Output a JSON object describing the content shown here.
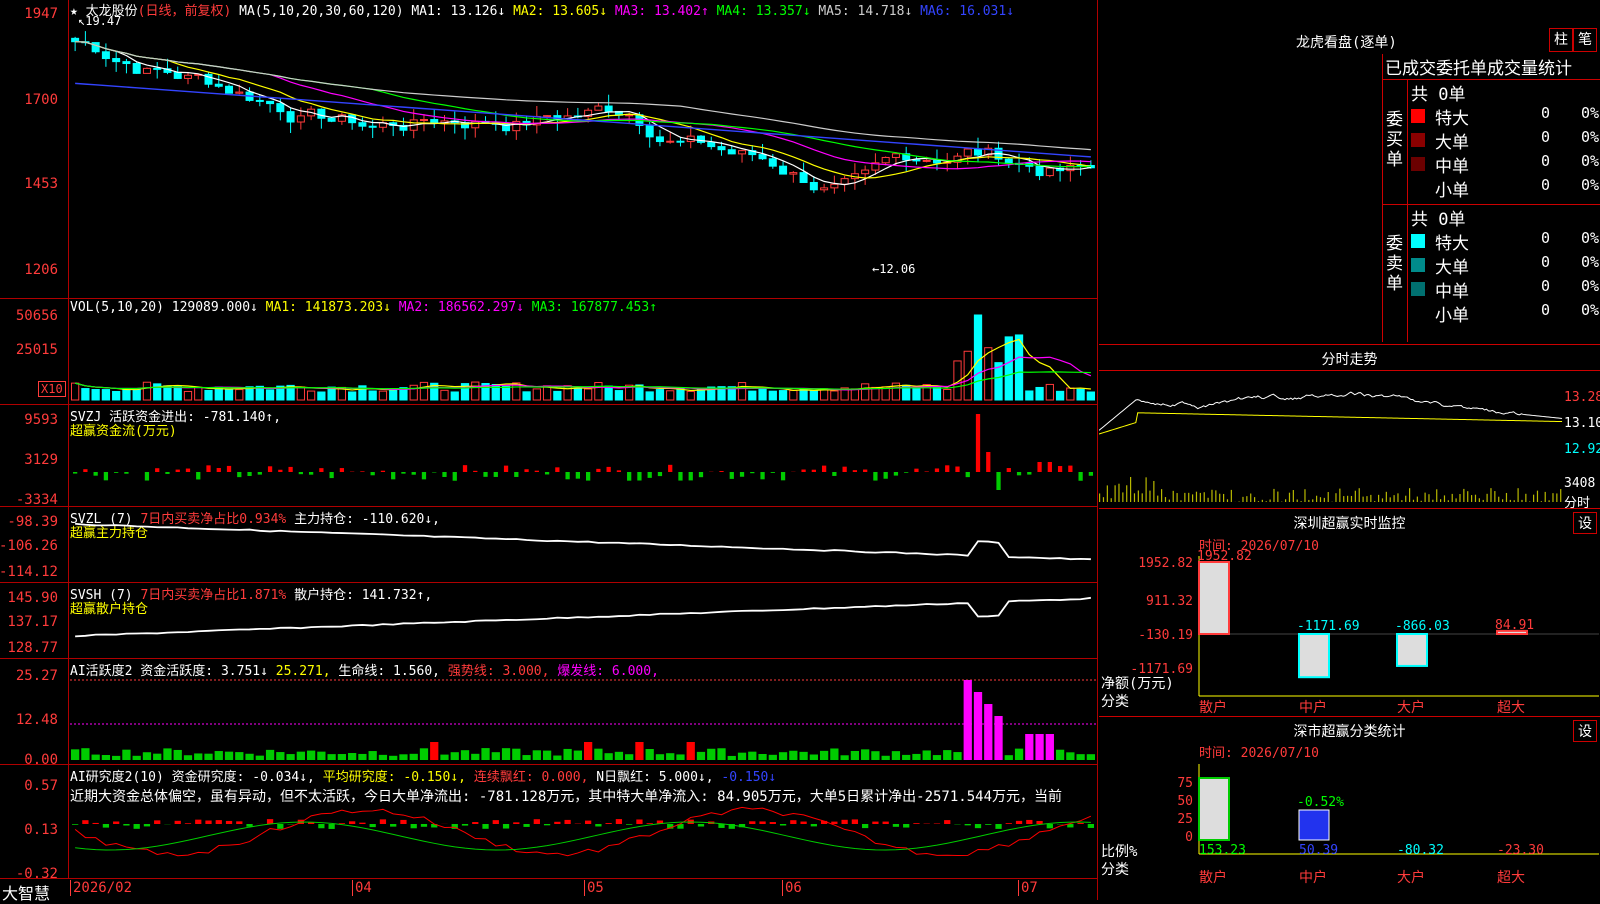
{
  "app": {
    "brand": "大智慧",
    "stock_name": "太龙股份",
    "period": "(日线，前复权)"
  },
  "price_panel": {
    "ma_label": "MA(5,10,20,30,60,120)",
    "ma": [
      {
        "name": "MA1:",
        "value": "13.126↓",
        "color": "#ffffff"
      },
      {
        "name": "MA2:",
        "value": "13.605↓",
        "color": "#ffff00"
      },
      {
        "name": "MA3:",
        "value": "13.402↑",
        "color": "#ff00ff"
      },
      {
        "name": "MA4:",
        "value": "13.357↓",
        "color": "#00ff00"
      },
      {
        "name": "MA5:",
        "value": "14.718↓",
        "color": "#cccccc"
      },
      {
        "name": "MA6:",
        "value": "16.031↓",
        "color": "#3344ff"
      }
    ],
    "y_ticks": [
      "1947",
      "1700",
      "1453",
      "1206"
    ],
    "high_label": "19.47",
    "low_label": "12.06"
  },
  "vol_panel": {
    "title": "VOL(5,10,20)",
    "value": "129089.000↓",
    "ma1": "MA1: 141873.203↓",
    "ma2": "MA2: 186562.297↓",
    "ma3": "MA3: 167877.453↑",
    "y_ticks": [
      "50656",
      "25015"
    ],
    "unit": "X10"
  },
  "svzj_panel": {
    "title": "SVZJ  活跃资金进出: -781.140↑,",
    "subtitle": "超赢资金流(万元)",
    "y_ticks": [
      "9593",
      "3129",
      "-3334"
    ]
  },
  "svzl_panel": {
    "title": "SVZL (7)",
    "ratio": "7日内买卖净占比0.934%",
    "hold": "主力持仓: -110.620↓,",
    "subtitle": "超赢主力持仓",
    "y_ticks": [
      "-98.39",
      "-106.26",
      "-114.12"
    ]
  },
  "svsh_panel": {
    "title": "SVSH (7)",
    "ratio": "7日内买卖净占比1.871%",
    "hold": "散户持仓: 141.732↑,",
    "subtitle": "超赢散户持仓",
    "y_ticks": [
      "145.90",
      "137.17",
      "128.77"
    ]
  },
  "ai_active_panel": {
    "title": "AI活跃度2 资金活跃度: 3.751↓",
    "v2": "25.271,",
    "life": "生命线: 1.560,",
    "strong": "强势线: 3.000,",
    "burst": "爆发线: 6.000,",
    "y_ticks": [
      "25.27",
      "12.48",
      "0.00"
    ]
  },
  "ai_research_panel": {
    "title": "AI研究度2(10) 资金研究度: -0.034↓,",
    "avg": "平均研究度: -0.150↓,",
    "red": "连续飘红: 0.000,",
    "nred": "N日飘红: 5.000↓,",
    "last": "-0.150↓",
    "note": "近期大资金总体偏空，虽有异动，但不太活跃，今日大单净流出: -781.128万元，其中特大单净流入: 84.905万元，大单5日累计净出-2571.544万元，当前",
    "y_ticks": [
      "0.57",
      "0.13",
      "-0.32"
    ]
  },
  "x_axis": [
    "2026/02",
    "04",
    "05",
    "06",
    "07"
  ],
  "right": {
    "longhu_title": "龙虎看盘(逐单)",
    "btn1": "柱",
    "btn2": "笔",
    "stats_title": "已成交委托单成交量统计",
    "buy_label": "委买单",
    "sell_label": "委卖单",
    "total": "共 0单",
    "rows": [
      {
        "label": "特大",
        "count": "0",
        "pct": "0%"
      },
      {
        "label": "大单",
        "count": "0",
        "pct": "0%"
      },
      {
        "label": "中单",
        "count": "0",
        "pct": "0%"
      },
      {
        "label": "小单",
        "count": "0",
        "pct": "0%"
      }
    ],
    "buy_colors": [
      "#ff0000",
      "#8b0000",
      "#6b0000",
      "#000000"
    ],
    "sell_colors": [
      "#00ffff",
      "#008b8b",
      "#007070",
      "#000000"
    ],
    "intraday_title": "分时走势",
    "intraday_ticks": [
      "13.28",
      "13.10",
      "12.92"
    ],
    "intraday_vol": "3408",
    "intraday_label": "分时",
    "monitor_title": "深圳超赢实时监控",
    "monitor_btn": "设",
    "monitor_time": "时间: 2026/07/10",
    "monitor_ticks": [
      "1952.82",
      "911.32",
      "-130.19",
      "-1171.69"
    ],
    "monitor_unit": "净额(万元)",
    "monitor_cat": "分类",
    "monitor_values": [
      "1952.82",
      "-1171.69",
      "-866.03",
      "84.91"
    ],
    "categories": [
      "散户",
      "中户",
      "大户",
      "超大"
    ],
    "class_title": "深市超赢分类统计",
    "class_btn": "设",
    "class_time": "时间: 2026/07/10",
    "class_ticks": [
      "75",
      "50",
      "25",
      "0"
    ],
    "class_unit": "比例%",
    "class_cat": "分类",
    "class_top": "-0.52%",
    "class_values": [
      "153.23",
      "50.39",
      "-80.32",
      "-23.30"
    ]
  }
}
